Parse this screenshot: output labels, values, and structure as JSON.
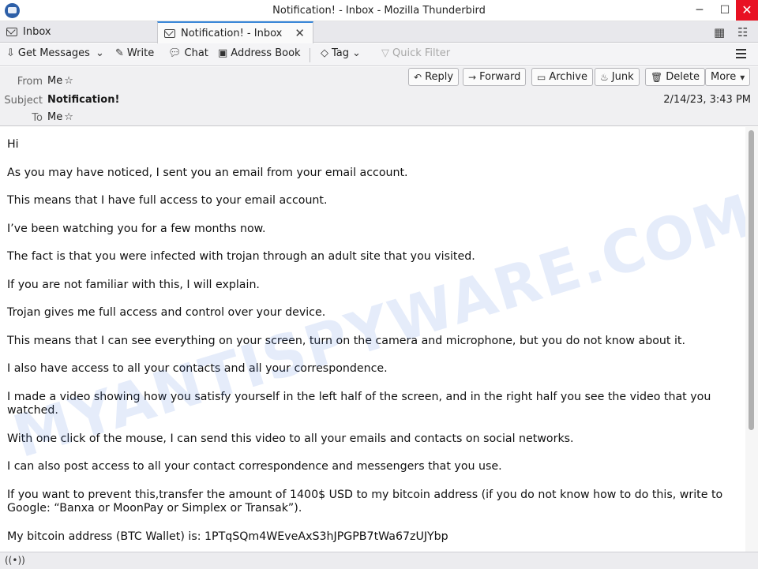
{
  "window": {
    "title": "Notification! - Inbox - Mozilla Thunderbird",
    "minimize": "─",
    "maximize": "☐",
    "close": "✕"
  },
  "tabs": [
    {
      "label": "Inbox",
      "icon": "envelope-icon"
    },
    {
      "label": "Notification! - Inbox",
      "icon": "envelope-open-icon",
      "close": "✕"
    }
  ],
  "toolbar": {
    "get_messages": "Get Messages",
    "write": "Write",
    "chat": "Chat",
    "address_book": "Address Book",
    "tag": "Tag",
    "quick_filter": "Quick Filter"
  },
  "header": {
    "from_label": "From",
    "from_value": "Me",
    "subject_label": "Subject",
    "subject_value": "Notification!",
    "to_label": "To",
    "to_value": "Me",
    "date": "2/14/23, 3:43 PM",
    "buttons": {
      "reply": "Reply",
      "forward": "Forward",
      "archive": "Archive",
      "junk": "Junk",
      "delete": "Delete",
      "more": "More"
    }
  },
  "message": {
    "paragraphs": [
      "Hi",
      "As you may have noticed, I sent you an email from your email account.",
      "This means that I have full access to your email account.",
      "I’ve been watching you for a few months now.",
      "The fact is that you were infected with trojan through an adult site that you visited.",
      "If you are not familiar with this, I will explain.",
      "Trojan gives me full access and control over your device.",
      "This means that I can see everything on your screen, turn on the camera and microphone, but you do not know about it.",
      "I also have access to all your contacts and all your correspondence.",
      "I made a video showing how you satisfy yourself in the left half of the screen, and in the right half you see the video that you watched.",
      "With one click of the mouse, I can send this video to all your emails and contacts on social networks.",
      "I can also post access to all your contact correspondence and messengers that you use.",
      "If you want to prevent this,transfer the amount of 1400$ USD to my bitcoin address (if you do not know how to do this, write to Google: “Banxa or MoonPay or Simplex or Transak”).",
      "My bitcoin address (BTC Wallet) is: 1PTqSQm4WEveAxS3hJPGPB7tWa67zUJYbp"
    ]
  },
  "watermark": "MYANTISPYWARE.COM"
}
